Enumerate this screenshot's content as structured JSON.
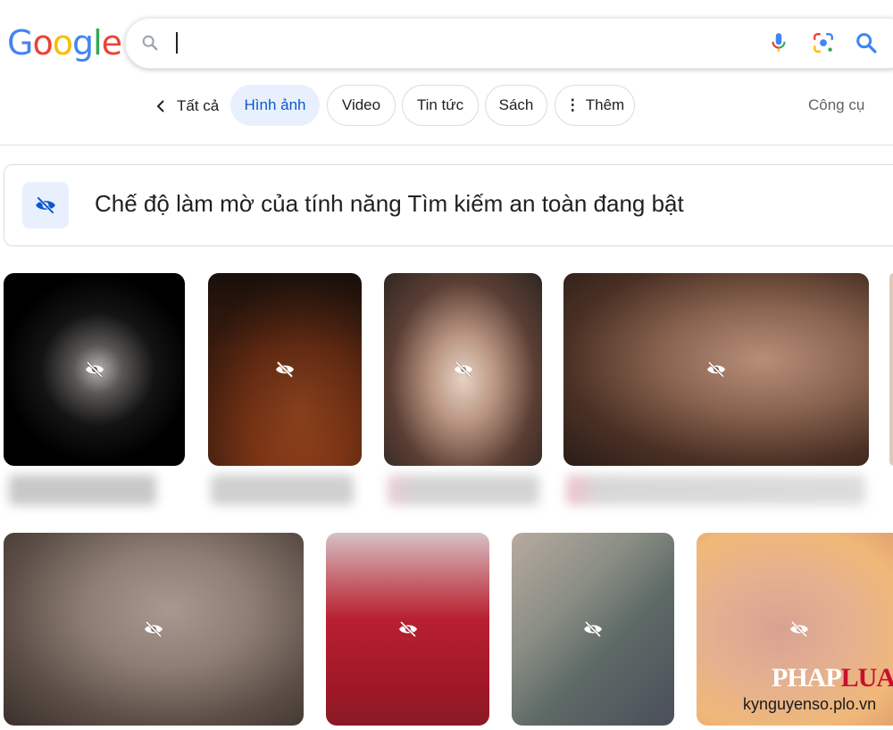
{
  "logo": {
    "letters": [
      "G",
      "o",
      "o",
      "g",
      "l",
      "e"
    ],
    "colors": [
      "#4285F4",
      "#EA4335",
      "#FBBC05",
      "#4285F4",
      "#34A853",
      "#EA4335"
    ]
  },
  "search": {
    "value": "",
    "icons": [
      "search-icon",
      "mic-icon",
      "lens-icon",
      "search-submit-icon"
    ]
  },
  "filters": {
    "back_label": "Tất cả",
    "chips": [
      {
        "label": "Hình ảnh",
        "active": true
      },
      {
        "label": "Video",
        "active": false
      },
      {
        "label": "Tin tức",
        "active": false
      },
      {
        "label": "Sách",
        "active": false
      },
      {
        "label": "Thêm",
        "active": false,
        "icon": "more-vert-icon"
      }
    ],
    "tools_label": "Công cụ"
  },
  "safe_search_banner": {
    "icon": "eye-off-icon",
    "text": "Chế độ làm mờ của tính năng Tìm kiếm an toàn đang bật"
  },
  "image_results": {
    "blurred": true,
    "overlay_icon": "eye-off-icon",
    "count_visible": 8
  },
  "watermark": {
    "brand_left": "PHAP",
    "brand_right": "LUAT",
    "site": "kynguyenso.plo.vn"
  },
  "colors": {
    "accent": "#0b57d0",
    "active_chip_bg": "#e8f0fe",
    "border": "#dadce0"
  }
}
